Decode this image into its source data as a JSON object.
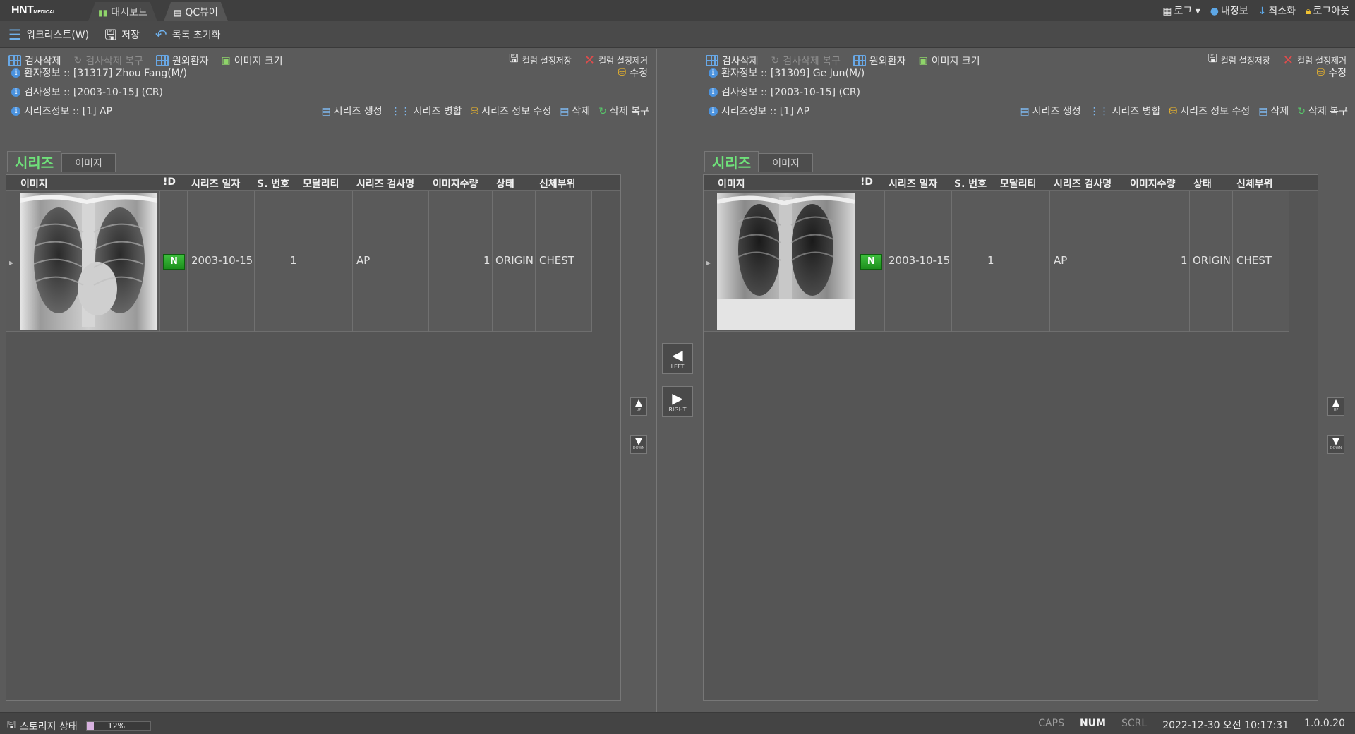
{
  "titlebar": {
    "logo": "HNT",
    "logo_sub": "MEDICAL",
    "tabs": [
      {
        "label": "대시보드",
        "icon": "bar-chart-icon"
      },
      {
        "label": "QC뷰어",
        "icon": "document-icon"
      }
    ],
    "right": [
      {
        "label": "로그",
        "icon": "log-icon"
      },
      {
        "label": "내정보",
        "icon": "info-icon"
      },
      {
        "label": "최소화",
        "icon": "minimize-icon"
      },
      {
        "label": "로그아웃",
        "icon": "lock-icon"
      }
    ]
  },
  "toolbar": {
    "worklist": "워크리스트(W)",
    "save": "저장",
    "reset": "목록 초기화"
  },
  "panels": [
    {
      "toolbar": {
        "delete_study": "검사삭제",
        "restore_study": "검사삭제 복구",
        "outside_patient": "원외환자",
        "image_size": "이미지 크기",
        "save_columns": "컬럼 설정저장",
        "remove_columns": "컬럼 설정제거"
      },
      "patient_info": "환자정보 :: [31317] Zhou Fang(M/)",
      "study_info": "검사정보 :: [2003-10-15] (CR)",
      "series_info": "시리즈정보 :: [1] AP",
      "edit": "수정",
      "series_actions": [
        "시리즈 생성",
        "시리즈 병합",
        "시리즈 정보 수정",
        "삭제",
        "삭제 복구"
      ],
      "tabs": {
        "series": "시리즈",
        "image": "이미지"
      },
      "columns": [
        "이미지",
        "!D",
        "시리즈 일자",
        "S. 번호",
        "모달리티",
        "시리즈 검사명",
        "이미지수량",
        "상태",
        "신체부위"
      ],
      "rows": [
        {
          "id_badge": "N",
          "date": "2003-10-15",
          "s_no": "1",
          "modality": "",
          "name": "AP",
          "count": "1",
          "status": "ORIGIN",
          "body": "CHEST"
        }
      ],
      "up_label": "UP",
      "down_label": "DOWN"
    },
    {
      "toolbar": {
        "delete_study": "검사삭제",
        "restore_study": "검사삭제 복구",
        "outside_patient": "원외환자",
        "image_size": "이미지 크기",
        "save_columns": "컬럼 설정저장",
        "remove_columns": "컬럼 설정제거"
      },
      "patient_info": "환자정보 :: [31309] Ge Jun(M/)",
      "study_info": "검사정보 :: [2003-10-15] (CR)",
      "series_info": "시리즈정보 :: [1] AP",
      "edit": "수정",
      "series_actions": [
        "시리즈 생성",
        "시리즈 병합",
        "시리즈 정보 수정",
        "삭제",
        "삭제 복구"
      ],
      "tabs": {
        "series": "시리즈",
        "image": "이미지"
      },
      "columns": [
        "이미지",
        "!D",
        "시리즈 일자",
        "S. 번호",
        "모달리티",
        "시리즈 검사명",
        "이미지수량",
        "상태",
        "신체부위"
      ],
      "rows": [
        {
          "id_badge": "N",
          "date": "2003-10-15",
          "s_no": "1",
          "modality": "",
          "name": "AP",
          "count": "1",
          "status": "ORIGIN",
          "body": "CHEST"
        }
      ],
      "up_label": "UP",
      "down_label": "DOWN"
    }
  ],
  "divider": {
    "left": "LEFT",
    "right": "RIGHT"
  },
  "status": {
    "storage_label": "스토리지 상태",
    "storage_percent": 12,
    "storage_text": "12%",
    "caps": "CAPS",
    "num": "NUM",
    "scrl": "SCRL",
    "datetime": "2022-12-30 오전 10:17:31",
    "version": "1.0.0.20"
  }
}
